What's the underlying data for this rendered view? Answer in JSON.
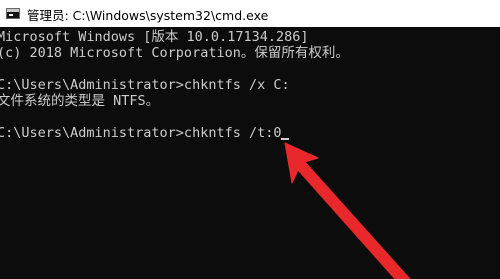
{
  "window": {
    "title": "管理员: C:\\Windows\\system32\\cmd.exe"
  },
  "console": {
    "lines": [
      "Microsoft Windows [版本 10.0.17134.286]",
      "(c) 2018 Microsoft Corporation。保留所有权利。",
      "",
      "C:\\Users\\Administrator>chkntfs /x C:",
      "文件系统的类型是 NTFS。",
      "",
      "C:\\Users\\Administrator>chkntfs /t:0"
    ]
  },
  "colors": {
    "console_bg": "#0c0c0c",
    "console_text": "#cccccc",
    "titlebar_bg": "#ffffff",
    "arrow": "#e8282b"
  },
  "icons": {
    "app": "cmd-console-icon",
    "annotation": "red-pointer-arrow"
  }
}
